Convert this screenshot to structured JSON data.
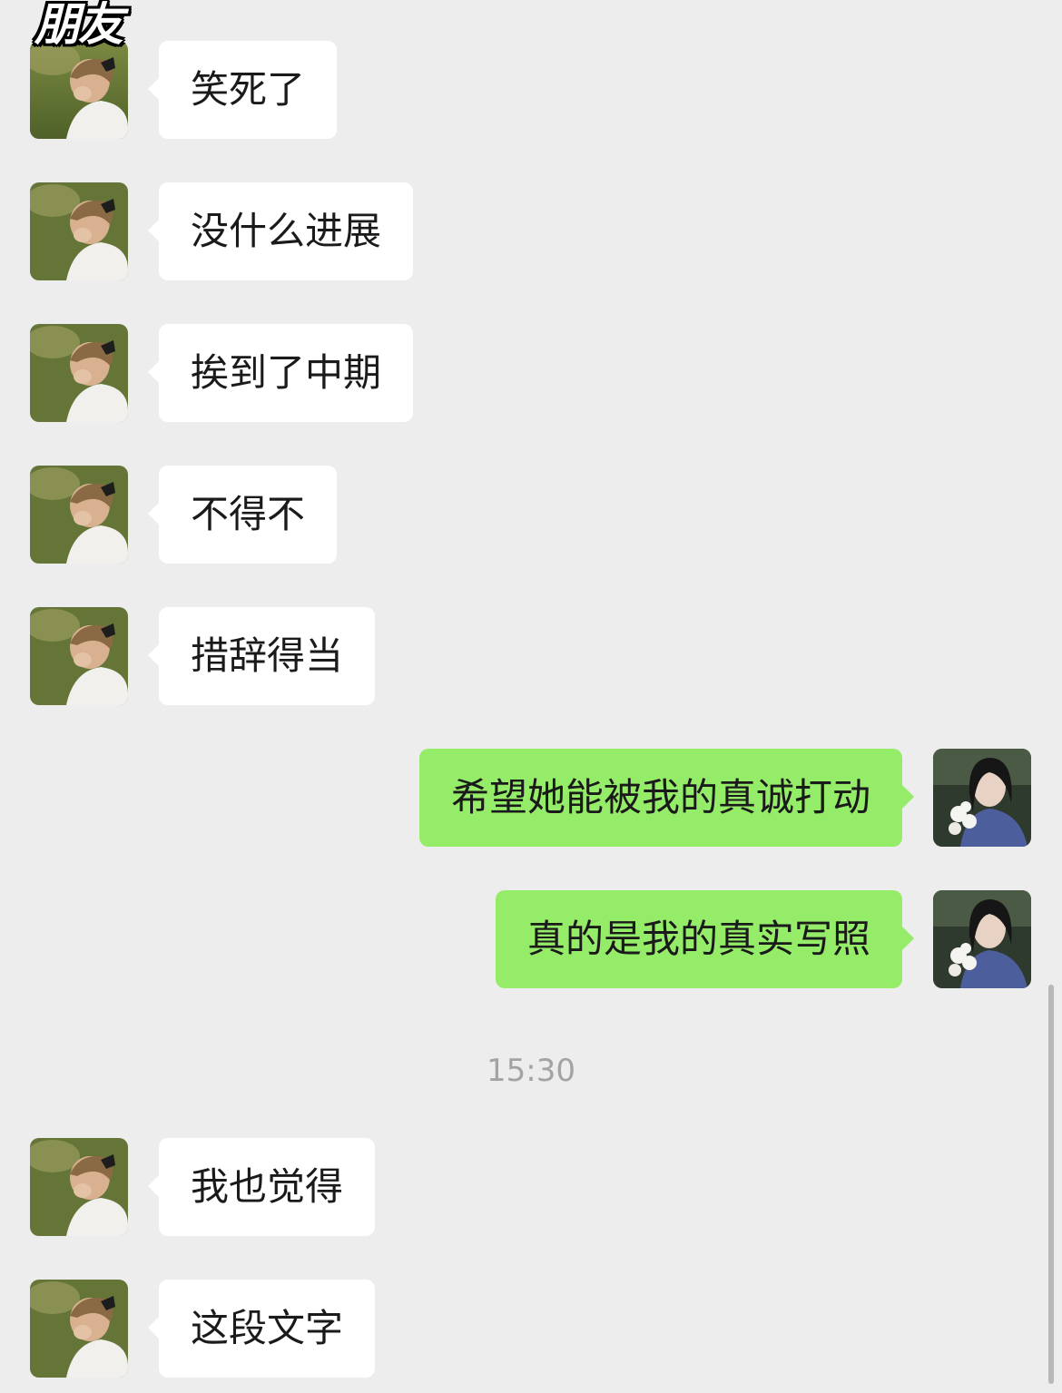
{
  "overlay_label": "朋友",
  "timestamp": "15:30",
  "colors": {
    "background": "#ededed",
    "incoming_bubble": "#ffffff",
    "outgoing_bubble": "#95ec69",
    "timestamp_text": "#a3a3a3"
  },
  "messages": [
    {
      "side": "left",
      "text": "笑死了"
    },
    {
      "side": "left",
      "text": "没什么进展"
    },
    {
      "side": "left",
      "text": "挨到了中期"
    },
    {
      "side": "left",
      "text": "不得不"
    },
    {
      "side": "left",
      "text": "措辞得当"
    },
    {
      "side": "right",
      "text": "希望她能被我的真诚打动"
    },
    {
      "side": "right",
      "text": "真的是我的真实写照"
    },
    {
      "side": "left",
      "text": "我也觉得"
    },
    {
      "side": "left",
      "text": "这段文字"
    }
  ],
  "icons": {
    "friend_avatar": "photo-avatar-woman-field",
    "self_avatar": "photo-avatar-woman-flowers"
  }
}
